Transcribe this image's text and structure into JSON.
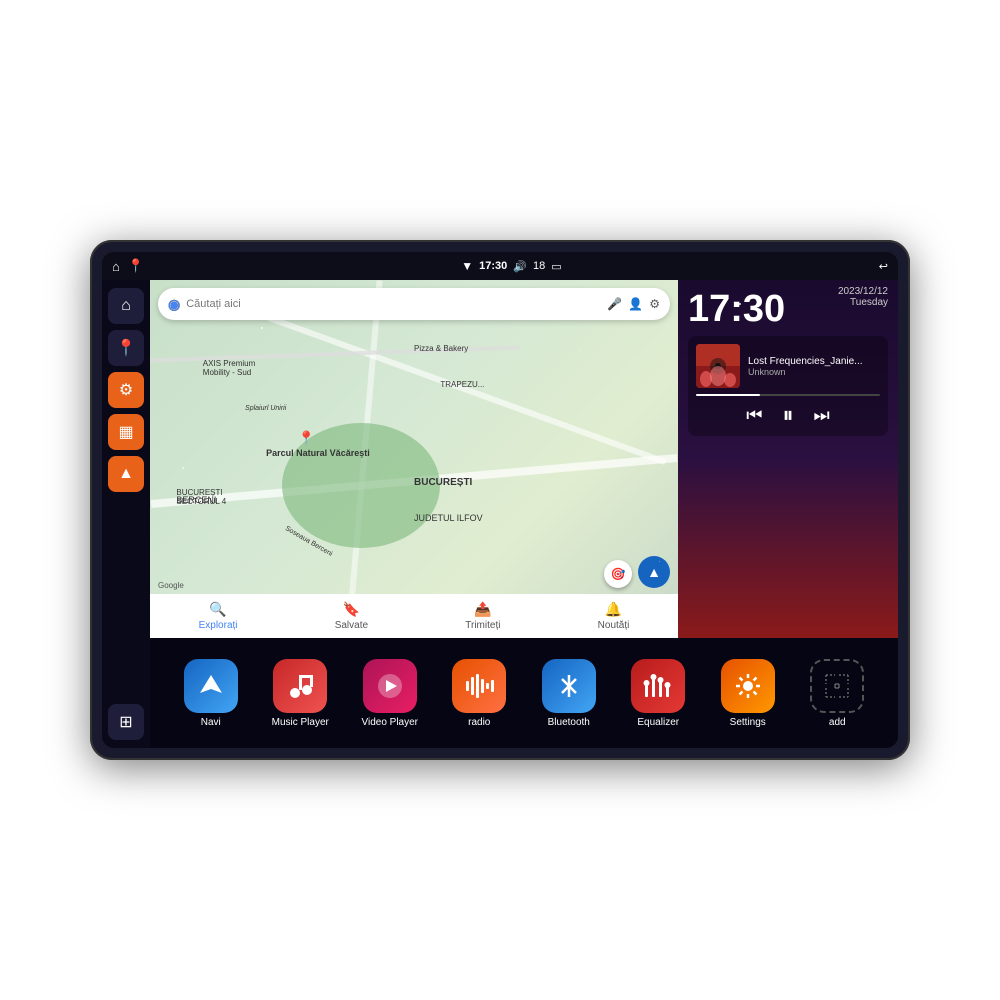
{
  "device": {
    "status_bar": {
      "wifi_icon": "▼",
      "time": "17:30",
      "volume_icon": "🔊",
      "battery_level": "18",
      "battery_icon": "🔋",
      "back_icon": "↩"
    },
    "sidebar": {
      "icons": [
        {
          "name": "home",
          "symbol": "⌂",
          "style": "dark"
        },
        {
          "name": "maps",
          "symbol": "📍",
          "style": "dark"
        },
        {
          "name": "settings",
          "symbol": "⚙",
          "style": "orange"
        },
        {
          "name": "files",
          "symbol": "▦",
          "style": "orange"
        },
        {
          "name": "navigation",
          "symbol": "▲",
          "style": "orange"
        },
        {
          "name": "grid",
          "symbol": "⊞",
          "style": "dark bottom"
        }
      ]
    },
    "map": {
      "search_placeholder": "Căutați aici",
      "bottom_items": [
        {
          "label": "Explorați",
          "icon": "🔍",
          "active": true
        },
        {
          "label": "Salvate",
          "icon": "🔖",
          "active": false
        },
        {
          "label": "Trimiteți",
          "icon": "📤",
          "active": false
        },
        {
          "label": "Noutăți",
          "icon": "🔔",
          "active": false
        }
      ],
      "labels": [
        "AXIS Premium Mobility - Sud",
        "Parcul Natural Văcărești",
        "Pizza & Bakery",
        "BUCUREȘTI",
        "BUCUREȘTI SECTORUL 4",
        "JUDETUL ILFOV",
        "BERCENI",
        "Splaiurl Unirii",
        "Soseaua Berceni"
      ]
    },
    "clock": {
      "time": "17:30",
      "date": "2023/12/12",
      "day": "Tuesday"
    },
    "music": {
      "title": "Lost Frequencies_Janie...",
      "artist": "Unknown",
      "controls": {
        "prev": "⏮",
        "play_pause": "⏸",
        "next": "⏭"
      }
    },
    "apps": [
      {
        "id": "navi",
        "label": "Navi",
        "style": "blue-nav"
      },
      {
        "id": "music-player",
        "label": "Music Player",
        "style": "red-music"
      },
      {
        "id": "video-player",
        "label": "Video Player",
        "style": "pink-video"
      },
      {
        "id": "radio",
        "label": "radio",
        "style": "orange-radio"
      },
      {
        "id": "bluetooth",
        "label": "Bluetooth",
        "style": "blue-bt"
      },
      {
        "id": "equalizer",
        "label": "Equalizer",
        "style": "red-eq"
      },
      {
        "id": "settings",
        "label": "Settings",
        "style": "orange-settings"
      },
      {
        "id": "add",
        "label": "add",
        "style": "add-icon"
      }
    ]
  }
}
